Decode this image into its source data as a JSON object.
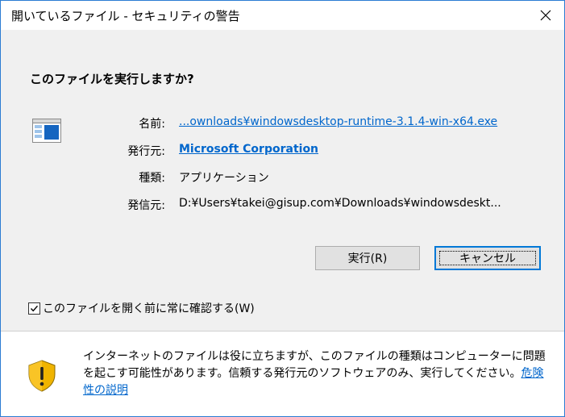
{
  "window": {
    "title": "開いているファイル - セキュリティの警告",
    "border_color": "#2b7cd3"
  },
  "icons": {
    "close": "close-icon",
    "file": "application-file-icon",
    "shield": "security-shield-warning-icon"
  },
  "question": "このファイルを実行しますか?",
  "info": {
    "name_label": "名前:",
    "name_value": "...ownloads¥windowsdesktop-runtime-3.1.4-win-x64.exe",
    "publisher_label": "発行元:",
    "publisher_value": "Microsoft Corporation",
    "type_label": "種類:",
    "type_value": "アプリケーション",
    "from_label": "発信元:",
    "from_value": "D:¥Users¥takei@gisup.com¥Downloads¥windowsdeskt..."
  },
  "buttons": {
    "run": "実行(R)",
    "cancel": "キャンセル"
  },
  "checkbox": {
    "label": "このファイルを開く前に常に確認する(W)",
    "checked": true
  },
  "warning": {
    "text": "インターネットのファイルは役に立ちますが、このファイルの種類はコンピューターに問題を起こす可能性があります。信頼する発行元のソフトウェアのみ、実行してください。",
    "link": "危険性の説明"
  },
  "colors": {
    "accent": "#0078d7",
    "link": "#0066cc",
    "shield_gold": "#f0b400"
  }
}
